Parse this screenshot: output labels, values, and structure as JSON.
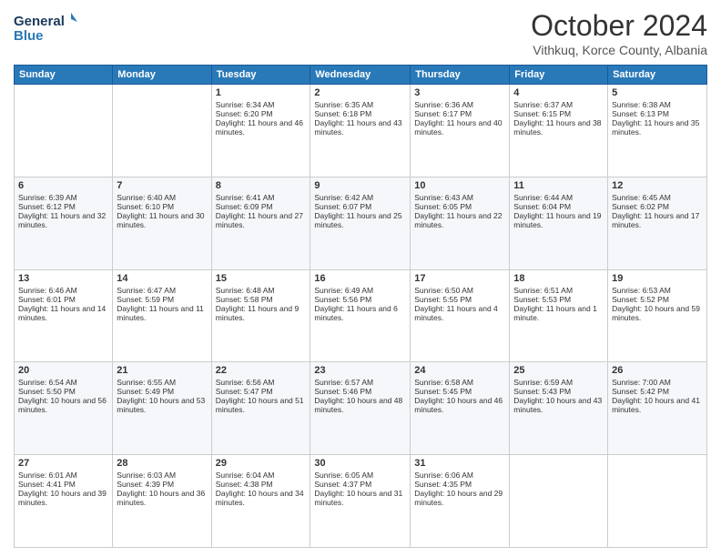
{
  "logo": {
    "line1": "General",
    "line2": "Blue"
  },
  "title": "October 2024",
  "location": "Vithkuq, Korce County, Albania",
  "days_of_week": [
    "Sunday",
    "Monday",
    "Tuesday",
    "Wednesday",
    "Thursday",
    "Friday",
    "Saturday"
  ],
  "weeks": [
    [
      {
        "day": "",
        "sunrise": "",
        "sunset": "",
        "daylight": ""
      },
      {
        "day": "",
        "sunrise": "",
        "sunset": "",
        "daylight": ""
      },
      {
        "day": "1",
        "sunrise": "Sunrise: 6:34 AM",
        "sunset": "Sunset: 6:20 PM",
        "daylight": "Daylight: 11 hours and 46 minutes."
      },
      {
        "day": "2",
        "sunrise": "Sunrise: 6:35 AM",
        "sunset": "Sunset: 6:18 PM",
        "daylight": "Daylight: 11 hours and 43 minutes."
      },
      {
        "day": "3",
        "sunrise": "Sunrise: 6:36 AM",
        "sunset": "Sunset: 6:17 PM",
        "daylight": "Daylight: 11 hours and 40 minutes."
      },
      {
        "day": "4",
        "sunrise": "Sunrise: 6:37 AM",
        "sunset": "Sunset: 6:15 PM",
        "daylight": "Daylight: 11 hours and 38 minutes."
      },
      {
        "day": "5",
        "sunrise": "Sunrise: 6:38 AM",
        "sunset": "Sunset: 6:13 PM",
        "daylight": "Daylight: 11 hours and 35 minutes."
      }
    ],
    [
      {
        "day": "6",
        "sunrise": "Sunrise: 6:39 AM",
        "sunset": "Sunset: 6:12 PM",
        "daylight": "Daylight: 11 hours and 32 minutes."
      },
      {
        "day": "7",
        "sunrise": "Sunrise: 6:40 AM",
        "sunset": "Sunset: 6:10 PM",
        "daylight": "Daylight: 11 hours and 30 minutes."
      },
      {
        "day": "8",
        "sunrise": "Sunrise: 6:41 AM",
        "sunset": "Sunset: 6:09 PM",
        "daylight": "Daylight: 11 hours and 27 minutes."
      },
      {
        "day": "9",
        "sunrise": "Sunrise: 6:42 AM",
        "sunset": "Sunset: 6:07 PM",
        "daylight": "Daylight: 11 hours and 25 minutes."
      },
      {
        "day": "10",
        "sunrise": "Sunrise: 6:43 AM",
        "sunset": "Sunset: 6:05 PM",
        "daylight": "Daylight: 11 hours and 22 minutes."
      },
      {
        "day": "11",
        "sunrise": "Sunrise: 6:44 AM",
        "sunset": "Sunset: 6:04 PM",
        "daylight": "Daylight: 11 hours and 19 minutes."
      },
      {
        "day": "12",
        "sunrise": "Sunrise: 6:45 AM",
        "sunset": "Sunset: 6:02 PM",
        "daylight": "Daylight: 11 hours and 17 minutes."
      }
    ],
    [
      {
        "day": "13",
        "sunrise": "Sunrise: 6:46 AM",
        "sunset": "Sunset: 6:01 PM",
        "daylight": "Daylight: 11 hours and 14 minutes."
      },
      {
        "day": "14",
        "sunrise": "Sunrise: 6:47 AM",
        "sunset": "Sunset: 5:59 PM",
        "daylight": "Daylight: 11 hours and 11 minutes."
      },
      {
        "day": "15",
        "sunrise": "Sunrise: 6:48 AM",
        "sunset": "Sunset: 5:58 PM",
        "daylight": "Daylight: 11 hours and 9 minutes."
      },
      {
        "day": "16",
        "sunrise": "Sunrise: 6:49 AM",
        "sunset": "Sunset: 5:56 PM",
        "daylight": "Daylight: 11 hours and 6 minutes."
      },
      {
        "day": "17",
        "sunrise": "Sunrise: 6:50 AM",
        "sunset": "Sunset: 5:55 PM",
        "daylight": "Daylight: 11 hours and 4 minutes."
      },
      {
        "day": "18",
        "sunrise": "Sunrise: 6:51 AM",
        "sunset": "Sunset: 5:53 PM",
        "daylight": "Daylight: 11 hours and 1 minute."
      },
      {
        "day": "19",
        "sunrise": "Sunrise: 6:53 AM",
        "sunset": "Sunset: 5:52 PM",
        "daylight": "Daylight: 10 hours and 59 minutes."
      }
    ],
    [
      {
        "day": "20",
        "sunrise": "Sunrise: 6:54 AM",
        "sunset": "Sunset: 5:50 PM",
        "daylight": "Daylight: 10 hours and 56 minutes."
      },
      {
        "day": "21",
        "sunrise": "Sunrise: 6:55 AM",
        "sunset": "Sunset: 5:49 PM",
        "daylight": "Daylight: 10 hours and 53 minutes."
      },
      {
        "day": "22",
        "sunrise": "Sunrise: 6:56 AM",
        "sunset": "Sunset: 5:47 PM",
        "daylight": "Daylight: 10 hours and 51 minutes."
      },
      {
        "day": "23",
        "sunrise": "Sunrise: 6:57 AM",
        "sunset": "Sunset: 5:46 PM",
        "daylight": "Daylight: 10 hours and 48 minutes."
      },
      {
        "day": "24",
        "sunrise": "Sunrise: 6:58 AM",
        "sunset": "Sunset: 5:45 PM",
        "daylight": "Daylight: 10 hours and 46 minutes."
      },
      {
        "day": "25",
        "sunrise": "Sunrise: 6:59 AM",
        "sunset": "Sunset: 5:43 PM",
        "daylight": "Daylight: 10 hours and 43 minutes."
      },
      {
        "day": "26",
        "sunrise": "Sunrise: 7:00 AM",
        "sunset": "Sunset: 5:42 PM",
        "daylight": "Daylight: 10 hours and 41 minutes."
      }
    ],
    [
      {
        "day": "27",
        "sunrise": "Sunrise: 6:01 AM",
        "sunset": "Sunset: 4:41 PM",
        "daylight": "Daylight: 10 hours and 39 minutes."
      },
      {
        "day": "28",
        "sunrise": "Sunrise: 6:03 AM",
        "sunset": "Sunset: 4:39 PM",
        "daylight": "Daylight: 10 hours and 36 minutes."
      },
      {
        "day": "29",
        "sunrise": "Sunrise: 6:04 AM",
        "sunset": "Sunset: 4:38 PM",
        "daylight": "Daylight: 10 hours and 34 minutes."
      },
      {
        "day": "30",
        "sunrise": "Sunrise: 6:05 AM",
        "sunset": "Sunset: 4:37 PM",
        "daylight": "Daylight: 10 hours and 31 minutes."
      },
      {
        "day": "31",
        "sunrise": "Sunrise: 6:06 AM",
        "sunset": "Sunset: 4:35 PM",
        "daylight": "Daylight: 10 hours and 29 minutes."
      },
      {
        "day": "",
        "sunrise": "",
        "sunset": "",
        "daylight": ""
      },
      {
        "day": "",
        "sunrise": "",
        "sunset": "",
        "daylight": ""
      }
    ]
  ]
}
